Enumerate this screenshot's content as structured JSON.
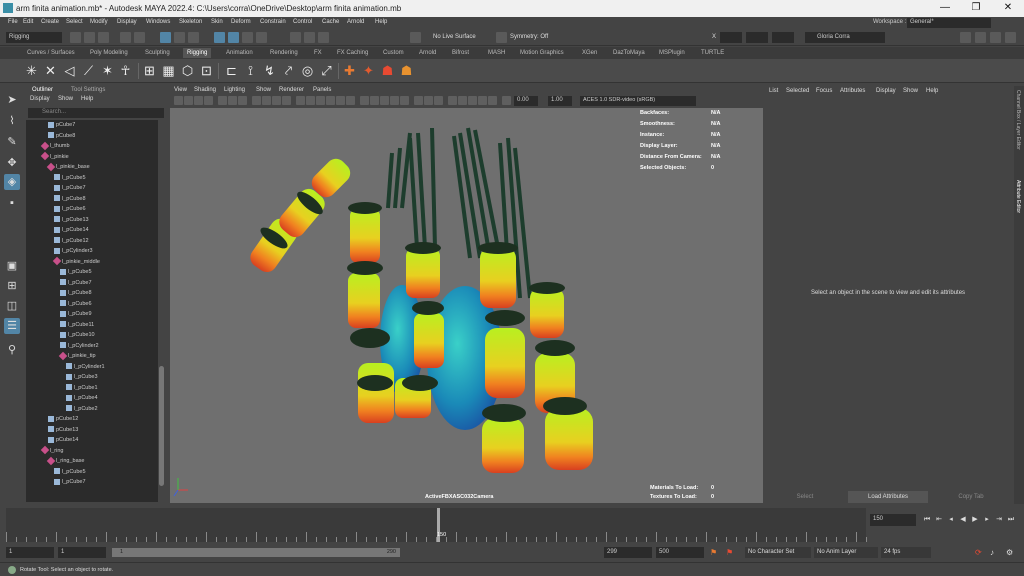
{
  "window": {
    "title": "arm finita animation.mb* - Autodesk MAYA 2022.4: C:\\Users\\corra\\OneDrive\\Desktop\\arm finita animation.mb",
    "minimize": "—",
    "maximize": "❐",
    "close": "✕"
  },
  "menu": [
    "File",
    "Edit",
    "Create",
    "Select",
    "Modify",
    "Display",
    "Windows",
    "Skeleton",
    "Skin",
    "Deform",
    "Constrain",
    "Control",
    "Cache",
    "Arnold",
    "Help"
  ],
  "workspace": {
    "label": "Workspace :",
    "value": "General*"
  },
  "status": {
    "mode": "Rigging",
    "live_surface": "No Live Surface",
    "symmetry": "Symmetry: Off",
    "x_label": "X",
    "user": "Gloria Corra"
  },
  "shelf_tabs": [
    "Curves / Surfaces",
    "Poly Modeling",
    "Sculpting",
    "Rigging",
    "Animation",
    "Rendering",
    "FX",
    "FX Caching",
    "Custom",
    "Arnold",
    "Bifrost",
    "MASH",
    "Motion Graphics",
    "XGen",
    "DazToMaya",
    "MSPlugin",
    "TURTLE"
  ],
  "outliner": {
    "tabs": [
      "Outliner",
      "Tool Settings"
    ],
    "menu": [
      "Display",
      "Show",
      "Help"
    ],
    "search_placeholder": "Search...",
    "rows": [
      {
        "label": "pCube7",
        "indent": 3,
        "type": "mesh"
      },
      {
        "label": "pCube8",
        "indent": 3,
        "type": "mesh"
      },
      {
        "label": "l_thumb",
        "indent": 2,
        "type": "joint"
      },
      {
        "label": "l_pinkie",
        "indent": 2,
        "type": "joint"
      },
      {
        "label": "l_pinkie_base",
        "indent": 3,
        "type": "joint"
      },
      {
        "label": "l_pCube5",
        "indent": 4,
        "type": "mesh"
      },
      {
        "label": "l_pCube7",
        "indent": 4,
        "type": "mesh"
      },
      {
        "label": "l_pCube8",
        "indent": 4,
        "type": "mesh"
      },
      {
        "label": "l_pCube6",
        "indent": 4,
        "type": "mesh"
      },
      {
        "label": "l_pCube13",
        "indent": 4,
        "type": "mesh"
      },
      {
        "label": "l_pCube14",
        "indent": 4,
        "type": "mesh"
      },
      {
        "label": "l_pCube12",
        "indent": 4,
        "type": "mesh"
      },
      {
        "label": "l_pCylinder3",
        "indent": 4,
        "type": "mesh"
      },
      {
        "label": "l_pinkie_middle",
        "indent": 4,
        "type": "joint"
      },
      {
        "label": "l_pCube5",
        "indent": 5,
        "type": "mesh"
      },
      {
        "label": "l_pCube7",
        "indent": 5,
        "type": "mesh"
      },
      {
        "label": "l_pCube8",
        "indent": 5,
        "type": "mesh"
      },
      {
        "label": "l_pCube6",
        "indent": 5,
        "type": "mesh"
      },
      {
        "label": "l_pCube9",
        "indent": 5,
        "type": "mesh"
      },
      {
        "label": "l_pCube11",
        "indent": 5,
        "type": "mesh"
      },
      {
        "label": "l_pCube10",
        "indent": 5,
        "type": "mesh"
      },
      {
        "label": "l_pCylinder2",
        "indent": 5,
        "type": "mesh"
      },
      {
        "label": "l_pinkie_tip",
        "indent": 5,
        "type": "joint"
      },
      {
        "label": "l_pCylinder1",
        "indent": 6,
        "type": "mesh"
      },
      {
        "label": "l_pCube3",
        "indent": 6,
        "type": "mesh"
      },
      {
        "label": "l_pCube1",
        "indent": 6,
        "type": "mesh"
      },
      {
        "label": "l_pCube4",
        "indent": 6,
        "type": "mesh"
      },
      {
        "label": "l_pCube2",
        "indent": 6,
        "type": "mesh"
      },
      {
        "label": "pCube12",
        "indent": 3,
        "type": "mesh"
      },
      {
        "label": "pCube13",
        "indent": 3,
        "type": "mesh"
      },
      {
        "label": "pCube14",
        "indent": 3,
        "type": "mesh"
      },
      {
        "label": "l_ring",
        "indent": 2,
        "type": "joint"
      },
      {
        "label": "l_ring_base",
        "indent": 3,
        "type": "joint"
      },
      {
        "label": "l_pCube5",
        "indent": 4,
        "type": "mesh"
      },
      {
        "label": "l_pCube7",
        "indent": 4,
        "type": "mesh"
      }
    ]
  },
  "viewport": {
    "menu": [
      "View",
      "Shading",
      "Lighting",
      "Show",
      "Renderer",
      "Panels"
    ],
    "exposure": "0.00",
    "gamma": "1.00",
    "colorspace": "ACES 1.0 SDR-video (sRGB)",
    "hud": [
      {
        "label": "Backfaces:",
        "value": "N/A"
      },
      {
        "label": "Smoothness:",
        "value": "N/A"
      },
      {
        "label": "Instance:",
        "value": "N/A"
      },
      {
        "label": "Display Layer:",
        "value": "N/A"
      },
      {
        "label": "Distance From Camera:",
        "value": "N/A"
      },
      {
        "label": "Selected Objects:",
        "value": "0"
      }
    ],
    "camera": "ActiveFBXASC032Camera",
    "materials_to_load": {
      "label": "Materials To Load:",
      "value": "0"
    },
    "textures_to_load": {
      "label": "Textures To Load:",
      "value": "0"
    }
  },
  "attribute_editor": {
    "menu": [
      "List",
      "Selected",
      "Focus",
      "Attributes",
      "Display",
      "Show",
      "Help"
    ],
    "message": "Select an object in the scene to view and edit its attributes",
    "buttons": [
      "Select",
      "Load Attributes",
      "Copy Tab"
    ],
    "side_tabs": [
      "Channel Box / Layer Editor",
      "Attribute Editor"
    ]
  },
  "timeline": {
    "current_frame": "150",
    "frame_field": "150"
  },
  "range": {
    "start": "1",
    "playback_start": "1",
    "slider_left": "1",
    "slider_right": "290",
    "playback_end": "299",
    "end": "500",
    "character_set": "No Character Set",
    "anim_layer": "No Anim Layer",
    "fps": "24 fps"
  },
  "help_line": "Rotate Tool: Select an object to rotate."
}
